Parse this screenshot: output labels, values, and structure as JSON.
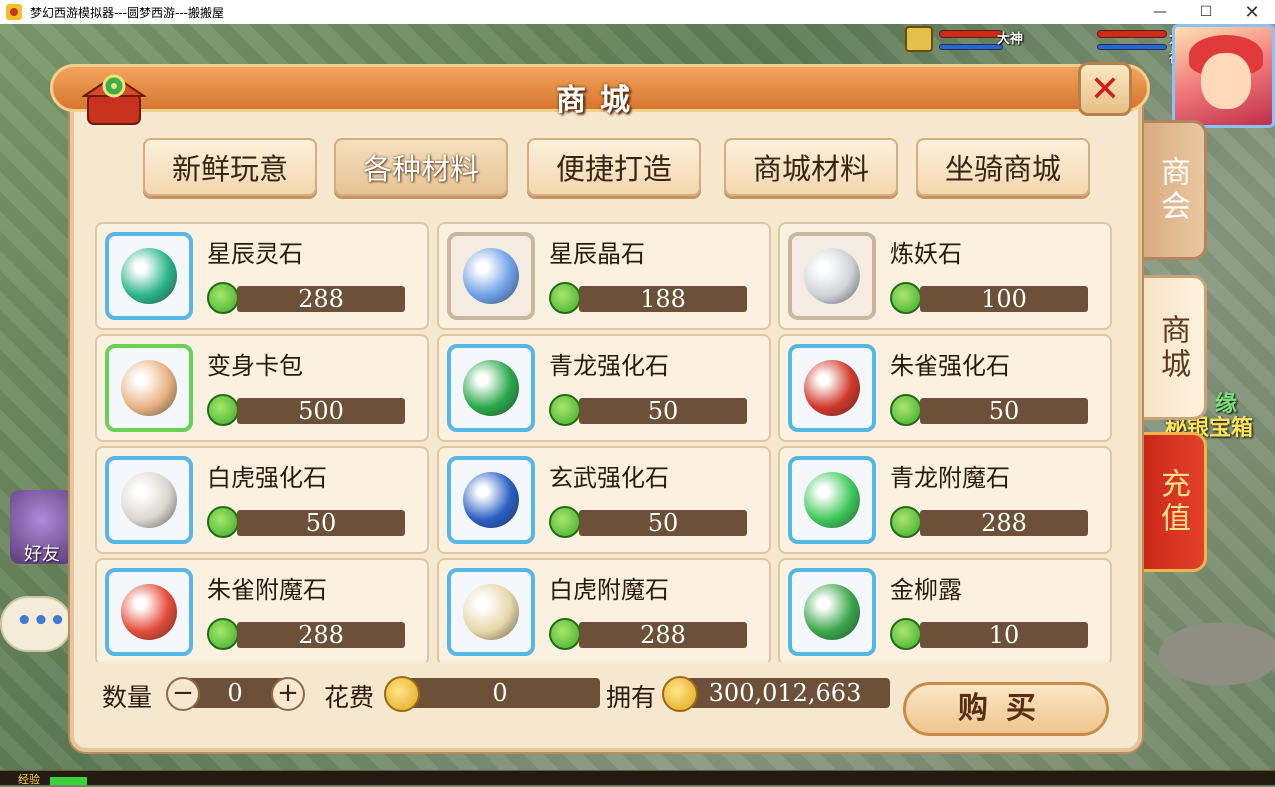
{
  "window": {
    "title": "梦幻西游模拟器---圆梦西游---搬搬屋"
  },
  "hud": {
    "badge1": "大神",
    "badge2": "大神",
    "friends": "好友",
    "chat": "•••",
    "treasure": "秘银宝箱",
    "fate": "缘"
  },
  "side_tabs": {
    "shanghui": "商会",
    "shangcheng": "商城",
    "chongzhi": "充值"
  },
  "shop": {
    "title": "商城",
    "categories": [
      "新鲜玩意",
      "各种材料",
      "便捷打造",
      "商城材料",
      "坐骑商城"
    ],
    "active_category": "各种材料",
    "items": [
      {
        "name": "星辰灵石",
        "price": "288",
        "icon": "gem-cluster-icon",
        "color": "#2bb58a"
      },
      {
        "name": "星辰晶石",
        "price": "188",
        "icon": "crystal-cluster-icon",
        "color": "#6fa0e8"
      },
      {
        "name": "炼妖石",
        "price": "100",
        "icon": "silver-stone-icon",
        "color": "#cfd3d6"
      },
      {
        "name": "变身卡包",
        "price": "500",
        "icon": "pouch-icon",
        "color": "#e9b383"
      },
      {
        "name": "青龙强化石",
        "price": "50",
        "icon": "green-dragon-stone-icon",
        "color": "#2aa84a"
      },
      {
        "name": "朱雀强化石",
        "price": "50",
        "icon": "red-phoenix-stone-icon",
        "color": "#d0382a"
      },
      {
        "name": "白虎强化石",
        "price": "50",
        "icon": "white-tiger-stone-icon",
        "color": "#d9d6cf"
      },
      {
        "name": "玄武强化石",
        "price": "50",
        "icon": "black-tortoise-stone-icon",
        "color": "#2a5fc6"
      },
      {
        "name": "青龙附魔石",
        "price": "288",
        "icon": "green-dragon-enchant-icon",
        "color": "#3ec85a"
      },
      {
        "name": "朱雀附魔石",
        "price": "288",
        "icon": "red-phoenix-enchant-icon",
        "color": "#e44c3a"
      },
      {
        "name": "白虎附魔石",
        "price": "288",
        "icon": "white-tiger-enchant-icon",
        "color": "#e6d7a8"
      },
      {
        "name": "金柳露",
        "price": "10",
        "icon": "gourd-bottle-icon",
        "color": "#3aa64a"
      }
    ],
    "footer": {
      "qty_label": "数量",
      "qty_value": "0",
      "cost_label": "花费",
      "cost_value": "0",
      "own_label": "拥有",
      "own_value": "300,012,663",
      "buy_label": "购买",
      "minus": "−",
      "plus": "+"
    }
  },
  "exp": {
    "label": "经验",
    "progress": 0.03
  }
}
